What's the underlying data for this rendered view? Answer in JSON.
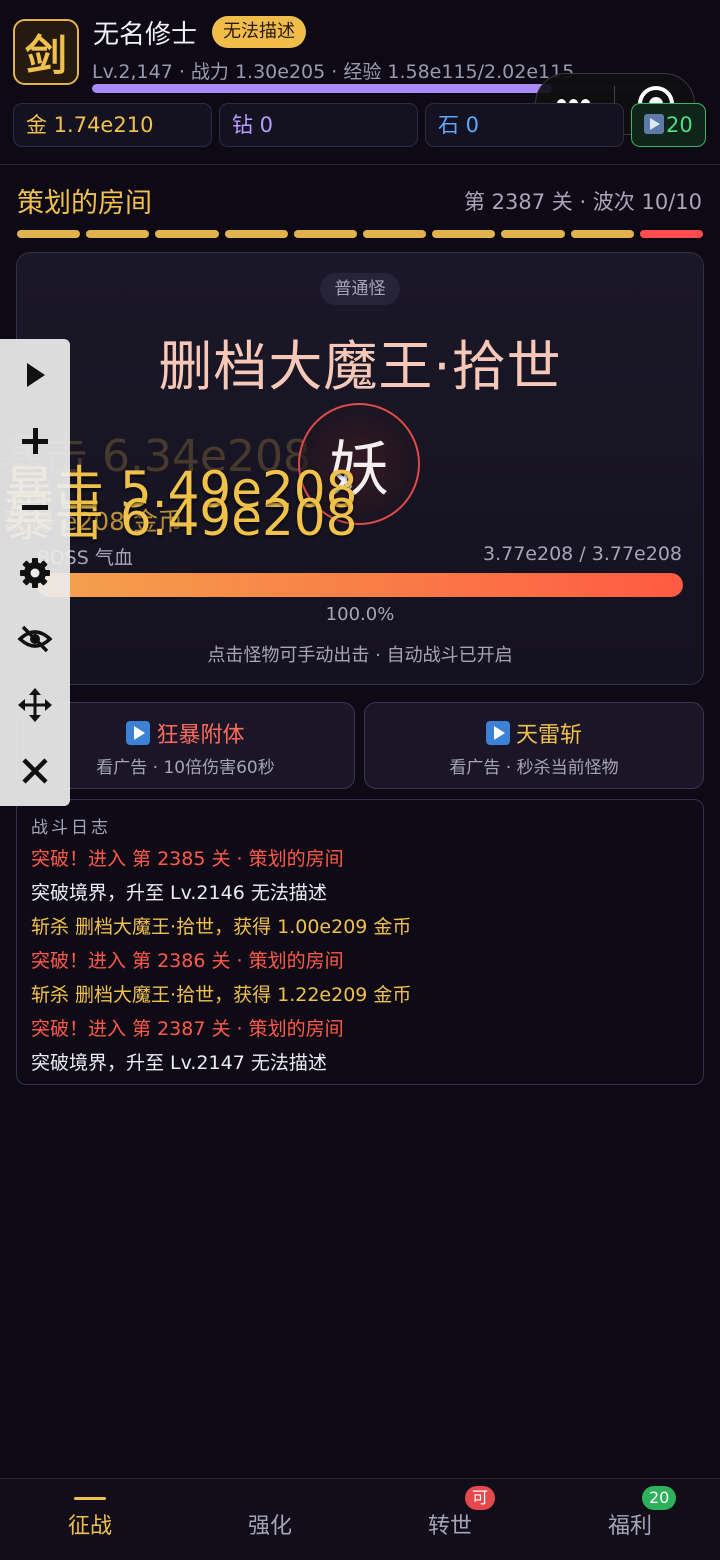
{
  "player": {
    "avatar_char": "剑",
    "name": "无名修士",
    "realm": "无法描述",
    "stats_line": "Lv.2,147 · 战力 1.30e205 · 经验 1.58e115/2.02e115",
    "exp_fraction": 0.78
  },
  "resources": {
    "gold": "金 1.74e210",
    "diamond": "钻 0",
    "stone": "石 0",
    "ad_count": "20"
  },
  "stage": {
    "name": "策划的房间",
    "info": "第 2387 关 · 波次 10/10",
    "waves_total": 10,
    "current_wave": 10,
    "wave_color": "#e2b24c",
    "current_wave_color": "#ff4d4d"
  },
  "monster": {
    "tag": "普通怪",
    "name": "删档大魔王·拾世",
    "avatar_char": "妖",
    "hp_label": "BOSS 气血",
    "hp_value": "3.77e208 / 3.77e208",
    "hp_fraction": 1.0,
    "hp_percent": "100.0%",
    "hint": "点击怪物可手动出击 · 自动战斗已开启"
  },
  "floating_text": {
    "crit_faint": "暴击 6.34e208",
    "crit_1": "暴击 5.49e208",
    "crit_2": "暴击 6.49e208",
    "gold_gain": "获得 e208 金币"
  },
  "ad_buttons": [
    {
      "title": "狂暴附体",
      "subtitle": "看广告 · 10倍伤害60秒"
    },
    {
      "title": "天雷斩",
      "subtitle": "看广告 · 秒杀当前怪物"
    }
  ],
  "log": {
    "title": "战斗日志",
    "lines": [
      {
        "text": "突破！进入 第 2385 关 · 策划的房间",
        "color": "#ff5a4a"
      },
      {
        "text": "突破境界，升至 Lv.2146 无法描述",
        "color": "#ecebf2"
      },
      {
        "text": "斩杀 删档大魔王·拾世，获得 1.00e209 金币",
        "color": "#f0c04e"
      },
      {
        "text": "突破！进入 第 2386 关 · 策划的房间",
        "color": "#ff5a4a"
      },
      {
        "text": "斩杀 删档大魔王·拾世，获得 1.22e209 金币",
        "color": "#f0c04e"
      },
      {
        "text": "突破！进入 第 2387 关 · 策划的房间",
        "color": "#ff5a4a"
      },
      {
        "text": "突破境界，升至 Lv.2147 无法描述",
        "color": "#ecebf2"
      }
    ]
  },
  "tools": [
    "play-icon",
    "zoom-in-icon",
    "zoom-out-icon",
    "settings-icon",
    "hide-icon",
    "move-icon",
    "close-icon"
  ],
  "nav": [
    {
      "label": "征战",
      "active": true
    },
    {
      "label": "强化"
    },
    {
      "label": "转世",
      "badge": "可"
    },
    {
      "label": "福利",
      "badge": "20"
    }
  ]
}
